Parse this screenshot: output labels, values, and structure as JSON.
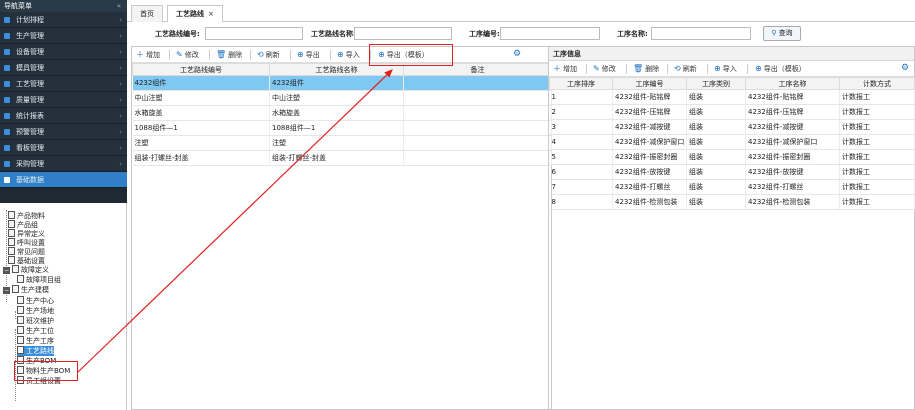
{
  "sidebar": {
    "title": "导航菜单",
    "collapse": "«",
    "items": [
      "计划排程",
      "生产管理",
      "设备管理",
      "模具管理",
      "工艺管理",
      "质量管理",
      "统计报表",
      "预警管理",
      "看板管理",
      "采购管理",
      "基础数据"
    ]
  },
  "tree": {
    "nodes": [
      "产品物料",
      "产品组",
      "异常定义",
      "呼叫设置",
      "常见问题",
      "基础设置",
      "故障定义",
      "故障项目组",
      "生产建模",
      "生产中心",
      "生产场地",
      "班次维护",
      "生产工位",
      "生产工序",
      "工艺路线",
      "生产BOM",
      "物料生产BOM",
      "员工组设置"
    ]
  },
  "tabs": [
    {
      "label": "首页"
    },
    {
      "label": "工艺路线",
      "close": "×"
    }
  ],
  "filter": {
    "route_code_label": "工艺路线编号:",
    "route_name_label": "工艺路线名称:",
    "proc_code_label": "工序编号:",
    "proc_name_label": "工序名称:",
    "query_label": "查询"
  },
  "left_toolbar": {
    "add": "增加",
    "edit": "修改",
    "delete": "删除",
    "refresh": "刷新",
    "export": "导出",
    "import": "导入",
    "export_tpl": "导出（模板）"
  },
  "left_table": {
    "headers": [
      "工艺路线编号",
      "工艺路线名称",
      "备注"
    ],
    "rows": [
      [
        "4232组件",
        "4232组件",
        ""
      ],
      [
        "中山注塑",
        "中山注塑",
        ""
      ],
      [
        "水箱旋盖",
        "水箱旋盖",
        ""
      ],
      [
        "1088组件—1",
        "1088组件—1",
        ""
      ],
      [
        "注塑",
        "注塑",
        ""
      ],
      [
        "组装-打螺丝-封盖",
        "组装-打螺丝-封盖",
        ""
      ]
    ]
  },
  "right_panel": {
    "title": "工序信息",
    "toolbar": {
      "add": "增加",
      "edit": "修改",
      "delete": "删除",
      "refresh": "刷新",
      "import": "导入",
      "export_tpl": "导出（模板）"
    },
    "headers": [
      "工序排序",
      "工序编号",
      "工序类别",
      "工序名称",
      "计数方式"
    ],
    "rows": [
      [
        "1",
        "4232组件-贴铭牌",
        "组装",
        "4232组件-贴铭牌",
        "计数报工"
      ],
      [
        "2",
        "4232组件-压铭牌",
        "组装",
        "4232组件-压铭牌",
        "计数报工"
      ],
      [
        "3",
        "4232组件-减按键",
        "组装",
        "4232组件-减按键",
        "计数报工"
      ],
      [
        "4",
        "4232组件-减保护窗口",
        "组装",
        "4232组件-减保护窗口",
        "计数报工"
      ],
      [
        "5",
        "4232组件-振密封圈",
        "组装",
        "4232组件-振密封圈",
        "计数报工"
      ],
      [
        "6",
        "4232组件-放按键",
        "组装",
        "4232组件-放按键",
        "计数报工"
      ],
      [
        "7",
        "4232组件-打螺丝",
        "组装",
        "4232组件-打螺丝",
        "计数报工"
      ],
      [
        "8",
        "4232组件-检测包装",
        "组装",
        "4232组件-检测包装",
        "计数报工"
      ]
    ]
  },
  "colors": {
    "annotation": "#e02020",
    "selected_row": "#7ec8f2",
    "sidebar_bg": "#1f2933",
    "accent": "#1e6fc0"
  }
}
